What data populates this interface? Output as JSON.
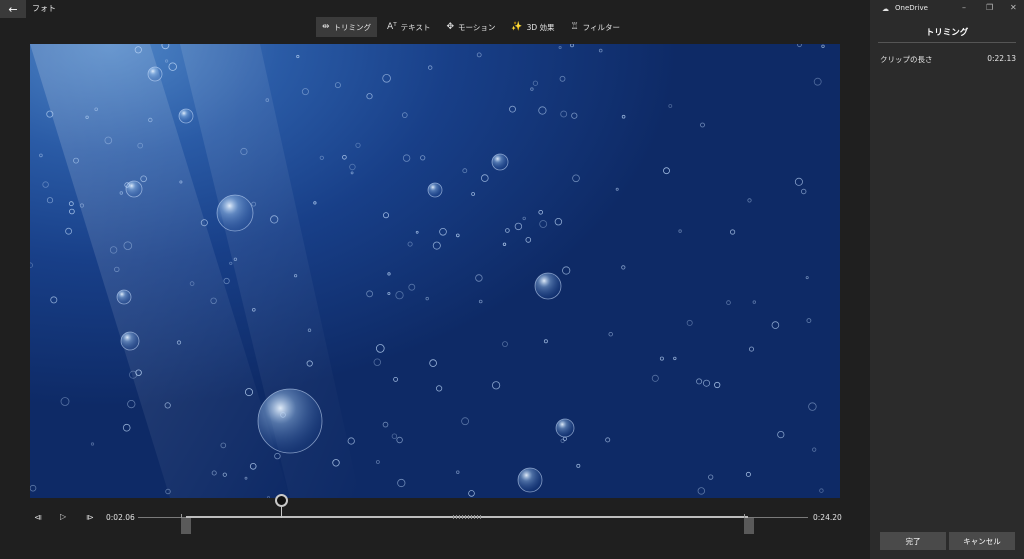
{
  "app": {
    "title": "フォト",
    "back_icon": "←"
  },
  "toolbar": {
    "tabs": [
      {
        "label": "トリミング",
        "icon": "trim-icon",
        "glyph": "⇹",
        "active": true
      },
      {
        "label": "テキスト",
        "icon": "text-icon",
        "glyph": "Aᵀ"
      },
      {
        "label": "モーション",
        "icon": "motion-icon",
        "glyph": "✥"
      },
      {
        "label": "3D 効果",
        "icon": "3d-effects-icon",
        "glyph": "✨"
      },
      {
        "label": "フィルター",
        "icon": "filter-icon",
        "glyph": "♖"
      }
    ]
  },
  "playback": {
    "prev_icon": "⧏",
    "play_icon": "▷",
    "next_icon": "⧐",
    "current_time": "0:02.06",
    "end_time": "0:24.20",
    "playhead_fraction": 0.095,
    "trim_start_fraction": 0.07,
    "trim_end_fraction": 0.91
  },
  "panel": {
    "account": "OneDrive",
    "cloud_icon": "☁",
    "minimize_icon": "–",
    "restore_icon": "❐",
    "close_icon": "✕",
    "title": "トリミング",
    "clip_length_label": "クリップの長さ",
    "clip_length_value": "0:22.13",
    "done_button": "完了",
    "cancel_button": "キャンセル"
  },
  "colors": {
    "accent": "#ffffff",
    "panel_bg": "#2b2b2b",
    "app_bg": "#1f1f1f",
    "water": "#183f88"
  }
}
